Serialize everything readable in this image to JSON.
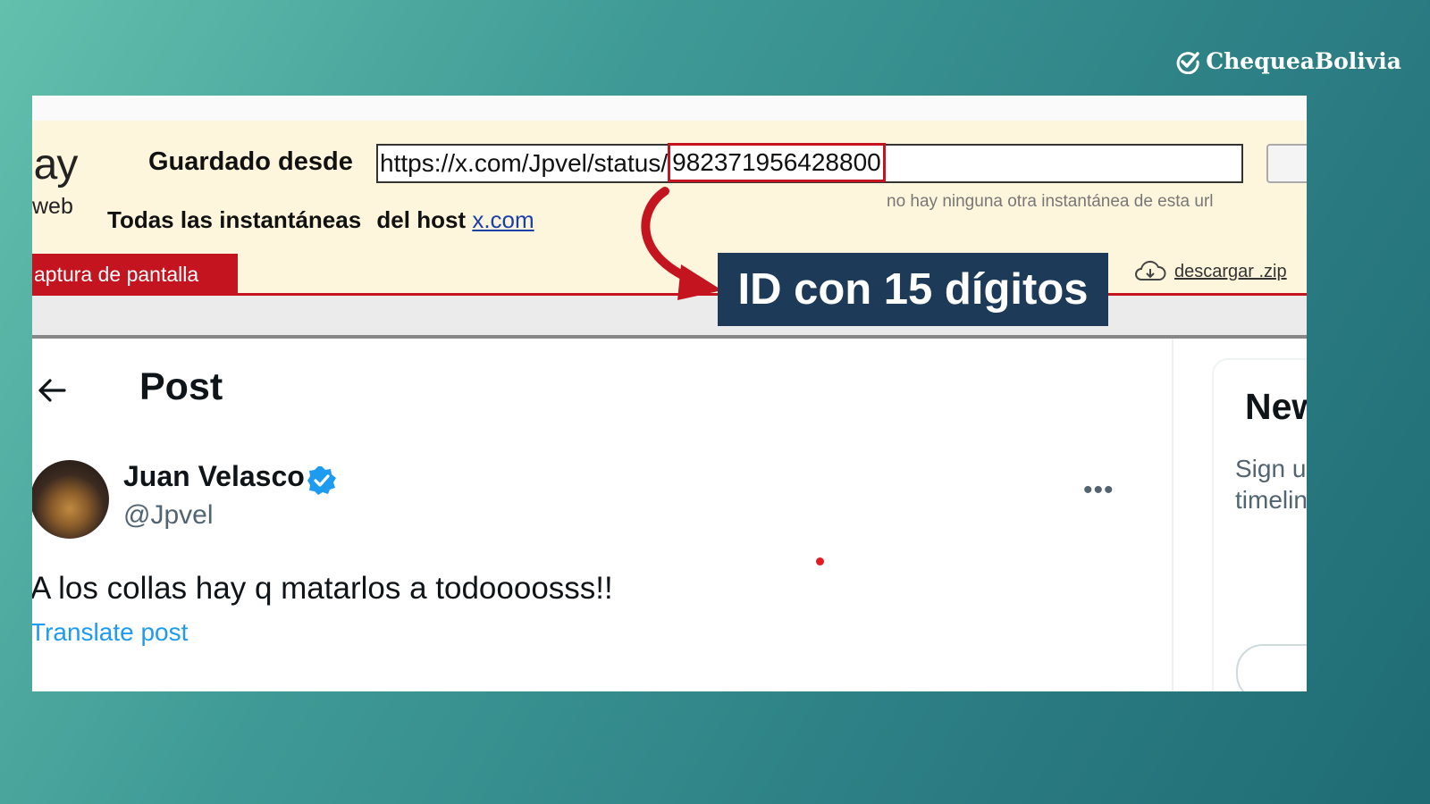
{
  "brand": {
    "name": "ChequeaBolivia",
    "icon": "check-circle-icon"
  },
  "wayback": {
    "logo_text": "lay",
    "logo_sub": "web",
    "saved_from_label": "Guardado desde",
    "url_prefix": "https://x.com/Jpvel/status/",
    "url_id": "982371956428800",
    "no_other_snapshots": "no hay ninguna otra instantánea de esta url",
    "all_snapshots_label": "Todas las instantáneas",
    "from_host_label": "del host",
    "host": "x.com",
    "screenshot_tab": "aptura de pantalla",
    "download_label": "descargar .zip",
    "download_icon": "cloud-download-icon"
  },
  "annotation": {
    "text": "ID con 15 dígitos",
    "box_color": "#1d3a58",
    "arrow_color": "#c4141f"
  },
  "post": {
    "back_icon": "arrow-left-icon",
    "title": "Post",
    "author_name": "Juan Velasco",
    "verified_icon": "verified-badge-icon",
    "handle": "@Jpvel",
    "more_icon": "more-horizontal-icon",
    "more_glyph": "•••",
    "text": "A los collas hay q matarlos a todoooosss!!",
    "translate_label": "Translate post"
  },
  "side_panel": {
    "title": "New",
    "text_line1": "Sign u",
    "text_line2": "timelin"
  },
  "colors": {
    "wayback_red": "#c4141f",
    "wayback_bg": "#fdf6dc",
    "x_blue": "#1d9bf0"
  }
}
